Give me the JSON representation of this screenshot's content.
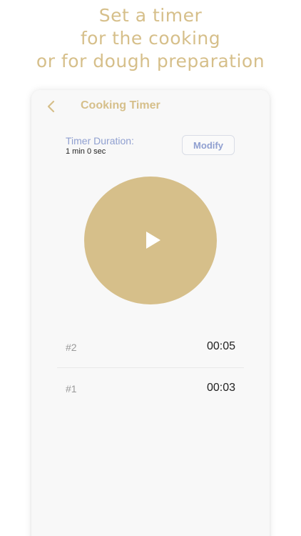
{
  "promo": {
    "line1": "Set a timer",
    "line2": "for the cooking",
    "line3": "or for dough preparation"
  },
  "nav": {
    "back_icon": "chevron-left-icon",
    "title": "Cooking Timer"
  },
  "timer": {
    "duration_label": "Timer Duration:",
    "duration_value": "1 min 0 sec",
    "modify_label": "Modify",
    "play_icon": "play-icon"
  },
  "laps": [
    {
      "number": "#2",
      "time": "00:05"
    },
    {
      "number": "#1",
      "time": "00:03"
    }
  ],
  "colors": {
    "accent_gold": "#d6bf8a",
    "accent_blue": "#8f9fd0",
    "background": "#f8f8f8"
  }
}
